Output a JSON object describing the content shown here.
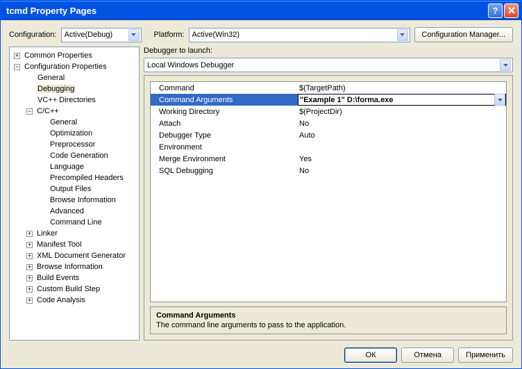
{
  "titlebar": {
    "title": "tcmd Property Pages"
  },
  "top": {
    "config_label": "Configuration:",
    "config_value": "Active(Debug)",
    "platform_label": "Platform:",
    "platform_value": "Active(Win32)",
    "config_mgr": "Configuration Manager..."
  },
  "tree": {
    "items": [
      {
        "indent": 0,
        "box": "+",
        "label": "Common Properties"
      },
      {
        "indent": 0,
        "box": "-",
        "label": "Configuration Properties"
      },
      {
        "indent": 1,
        "box": "",
        "label": "General"
      },
      {
        "indent": 1,
        "box": "",
        "label": "Debugging",
        "sel": true
      },
      {
        "indent": 1,
        "box": "",
        "label": "VC++ Directories"
      },
      {
        "indent": 1,
        "box": "-",
        "label": "C/C++"
      },
      {
        "indent": 2,
        "box": "",
        "label": "General"
      },
      {
        "indent": 2,
        "box": "",
        "label": "Optimization"
      },
      {
        "indent": 2,
        "box": "",
        "label": "Preprocessor"
      },
      {
        "indent": 2,
        "box": "",
        "label": "Code Generation"
      },
      {
        "indent": 2,
        "box": "",
        "label": "Language"
      },
      {
        "indent": 2,
        "box": "",
        "label": "Precompiled Headers"
      },
      {
        "indent": 2,
        "box": "",
        "label": "Output Files"
      },
      {
        "indent": 2,
        "box": "",
        "label": "Browse Information"
      },
      {
        "indent": 2,
        "box": "",
        "label": "Advanced"
      },
      {
        "indent": 2,
        "box": "",
        "label": "Command Line"
      },
      {
        "indent": 1,
        "box": "+",
        "label": "Linker"
      },
      {
        "indent": 1,
        "box": "+",
        "label": "Manifest Tool"
      },
      {
        "indent": 1,
        "box": "+",
        "label": "XML Document Generator"
      },
      {
        "indent": 1,
        "box": "+",
        "label": "Browse Information"
      },
      {
        "indent": 1,
        "box": "+",
        "label": "Build Events"
      },
      {
        "indent": 1,
        "box": "+",
        "label": "Custom Build Step"
      },
      {
        "indent": 1,
        "box": "+",
        "label": "Code Analysis"
      }
    ]
  },
  "right": {
    "launch_label": "Debugger to launch:",
    "launch_value": "Local Windows Debugger",
    "grid": [
      {
        "name": "Command",
        "value": "$(TargetPath)"
      },
      {
        "name": "Command Arguments",
        "value": "\"Example 1\" D:\\forma.exe",
        "sel": true
      },
      {
        "name": "Working Directory",
        "value": "$(ProjectDir)"
      },
      {
        "name": "Attach",
        "value": "No"
      },
      {
        "name": "Debugger Type",
        "value": "Auto"
      },
      {
        "name": "Environment",
        "value": ""
      },
      {
        "name": "Merge Environment",
        "value": "Yes"
      },
      {
        "name": "SQL Debugging",
        "value": "No"
      }
    ],
    "desc_title": "Command Arguments",
    "desc_text": "The command line arguments to pass to the application."
  },
  "buttons": {
    "ok": "ОК",
    "cancel": "Отмена",
    "apply": "Применить"
  }
}
